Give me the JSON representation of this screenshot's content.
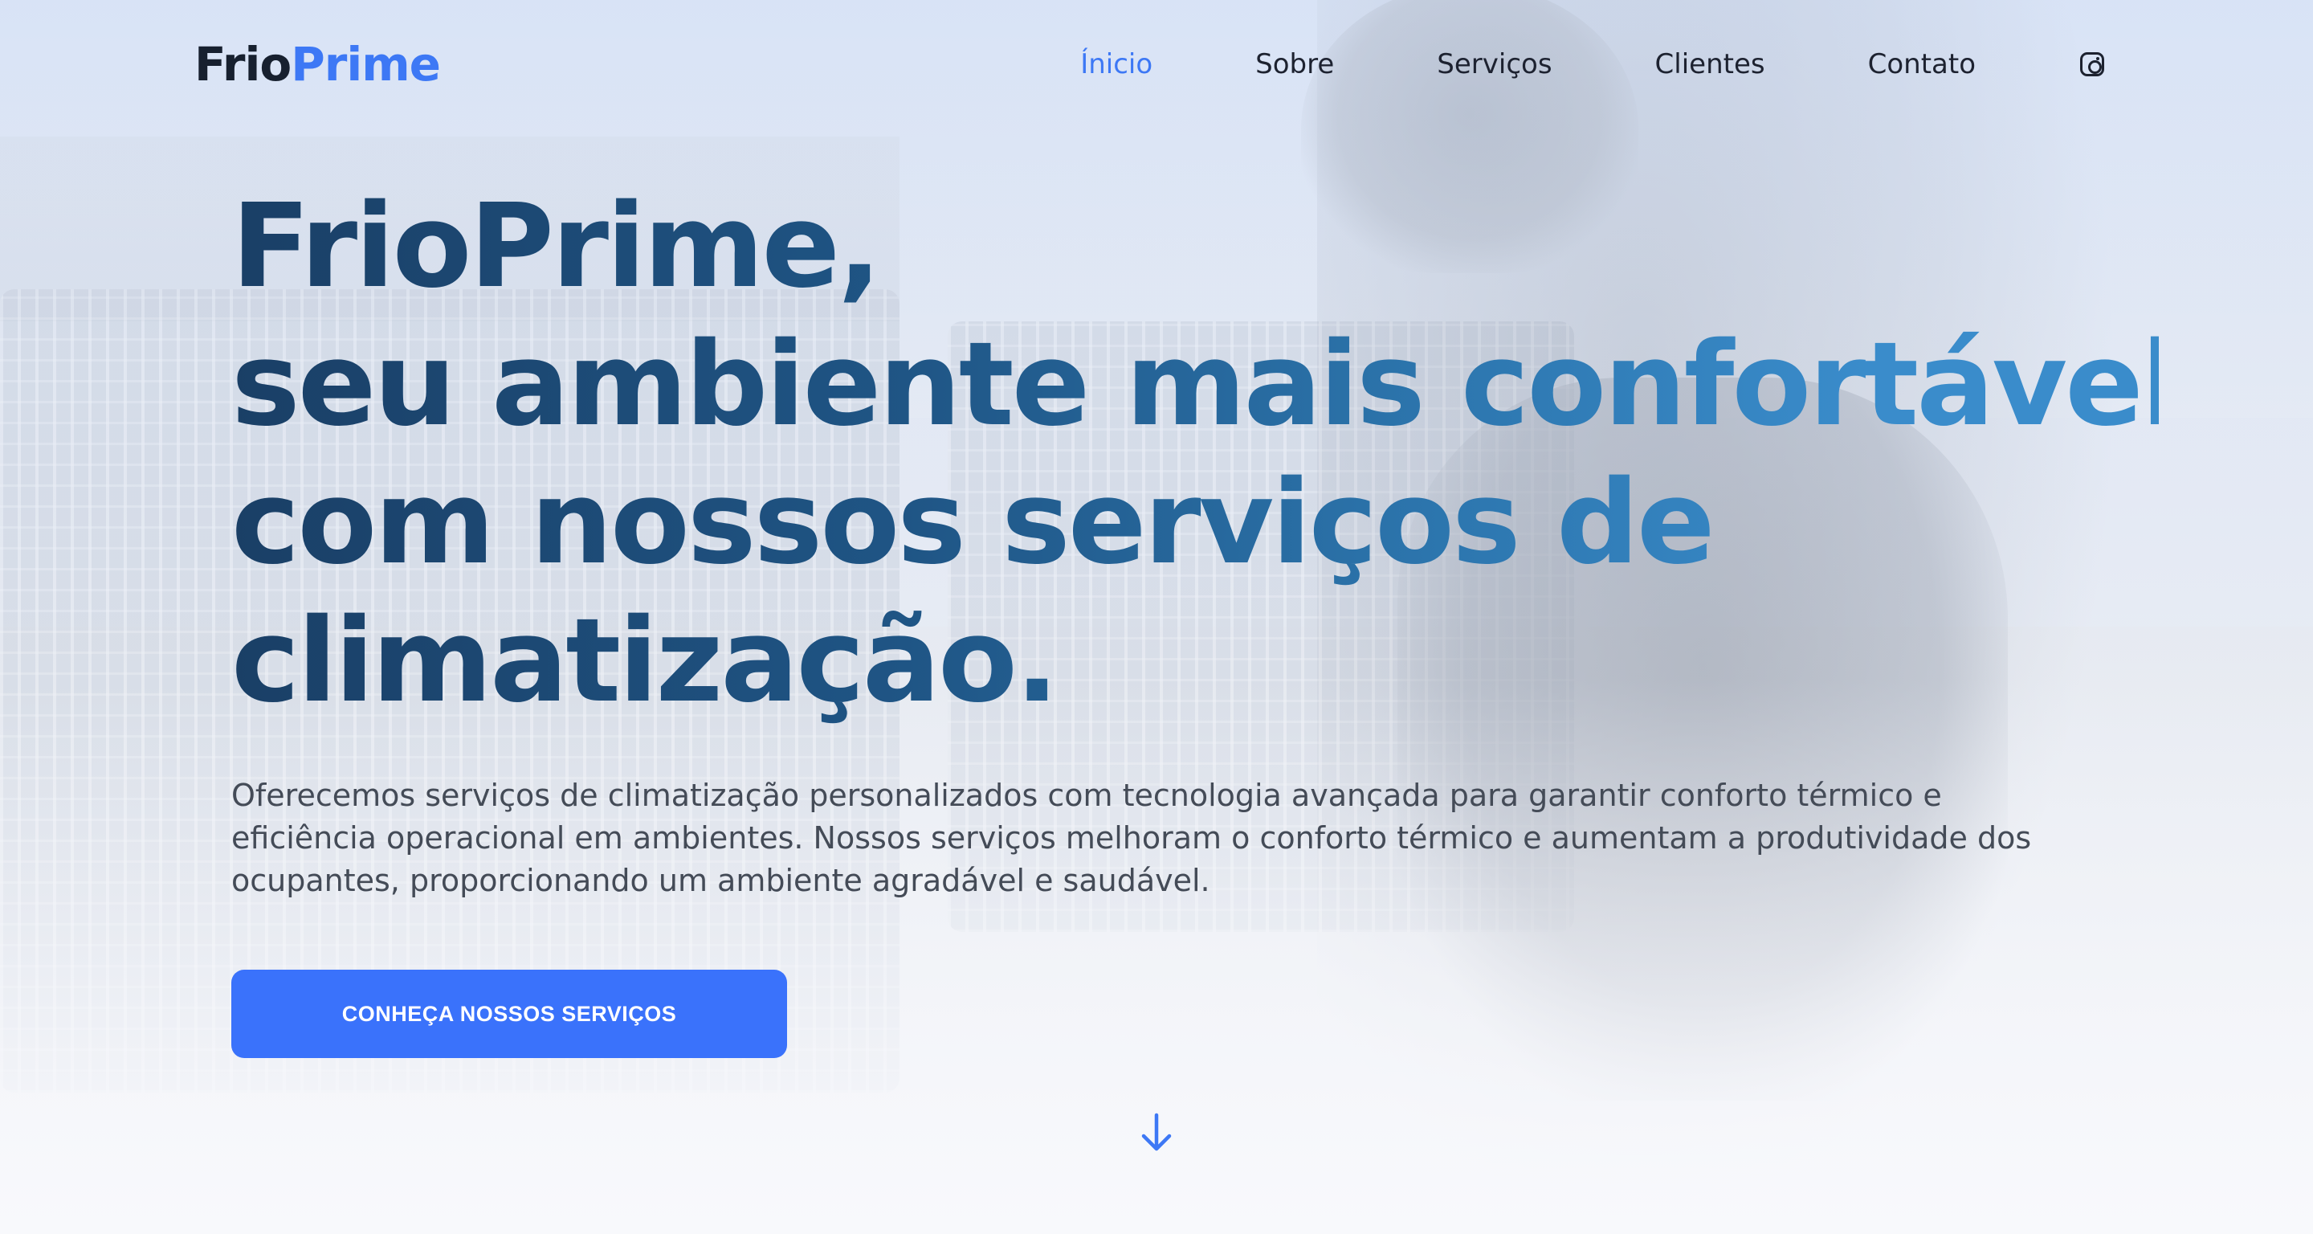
{
  "brand": {
    "part1": "Frio",
    "part2": "Prime",
    "accent_color": "#3d78f5",
    "dark_color": "#17202f"
  },
  "nav": {
    "items": [
      {
        "label": "Ínicio",
        "active": true
      },
      {
        "label": "Sobre",
        "active": false
      },
      {
        "label": "Serviços",
        "active": false
      },
      {
        "label": "Clientes",
        "active": false
      },
      {
        "label": "Contato",
        "active": false
      }
    ],
    "social_icon": "instagram-icon"
  },
  "hero": {
    "headline_lines": [
      "FrioPrime,",
      "seu ambiente mais confortável",
      "com nossos serviços de",
      "climatização."
    ],
    "description": "Oferecemos serviços de climatização personalizados com tecnologia avançada para garantir conforto térmico e eficiência operacional em ambientes. Nossos serviços melhoram o conforto térmico e aumentam a produtividade dos ocupantes, proporcionando um ambiente agradável e saudável.",
    "cta_label": "CONHEÇA NOSSOS SERVIÇOS",
    "cta_color": "#3a72fb",
    "headline_gradient": [
      "#1a3f66",
      "#3a8ccb"
    ]
  },
  "scroll": {
    "icon": "arrow-down-icon",
    "color": "#3d78f5"
  }
}
